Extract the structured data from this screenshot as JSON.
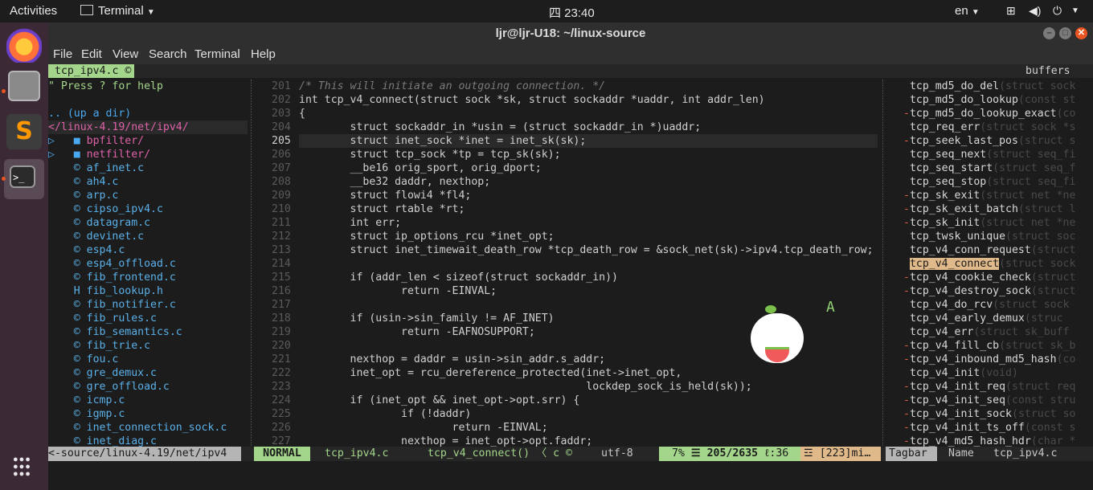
{
  "topbar": {
    "activities": "Activities",
    "app_name": "Terminal",
    "clock": "四 23:40",
    "input_method": "en"
  },
  "window": {
    "title": "ljr@ljr-U18: ~/linux-source",
    "menu": [
      "File",
      "Edit",
      "View",
      "Search",
      "Terminal",
      "Help"
    ]
  },
  "vim": {
    "tab_file": "tcp_ipv4.c",
    "tab_right": "buffers",
    "nerdtree": {
      "help": "\" Press ? for help",
      "up_dir": ".. (up a dir)",
      "cwd": "</linux-4.19/net/ipv4/",
      "dirs": [
        "bpfilter/",
        "netfilter/"
      ],
      "files": [
        "af_inet.c",
        "ah4.c",
        "arp.c",
        "cipso_ipv4.c",
        "datagram.c",
        "devinet.c",
        "esp4.c",
        "esp4_offload.c",
        "fib_frontend.c",
        "fib_lookup.h",
        "fib_notifier.c",
        "fib_rules.c",
        "fib_semantics.c",
        "fib_trie.c",
        "fou.c",
        "gre_demux.c",
        "gre_offload.c",
        "icmp.c",
        "igmp.c",
        "inet_connection_sock.c",
        "inet_diag.c"
      ]
    },
    "code": [
      {
        "n": "201",
        "t": "/* This will initiate an outgoing connection. */"
      },
      {
        "n": "202",
        "t": "int tcp_v4_connect(struct sock *sk, struct sockaddr *uaddr, int addr_len)"
      },
      {
        "n": "203",
        "t": "{"
      },
      {
        "n": "204",
        "t": "        struct sockaddr_in *usin = (struct sockaddr_in *)uaddr;"
      },
      {
        "n": "205",
        "t": "        struct inet_sock *inet = inet_sk(sk);"
      },
      {
        "n": "206",
        "t": "        struct tcp_sock *tp = tcp_sk(sk);"
      },
      {
        "n": "207",
        "t": "        __be16 orig_sport, orig_dport;"
      },
      {
        "n": "208",
        "t": "        __be32 daddr, nexthop;"
      },
      {
        "n": "209",
        "t": "        struct flowi4 *fl4;"
      },
      {
        "n": "210",
        "t": "        struct rtable *rt;"
      },
      {
        "n": "211",
        "t": "        int err;"
      },
      {
        "n": "212",
        "t": "        struct ip_options_rcu *inet_opt;"
      },
      {
        "n": "213",
        "t": "        struct inet_timewait_death_row *tcp_death_row = &sock_net(sk)->ipv4.tcp_death_row;"
      },
      {
        "n": "214",
        "t": ""
      },
      {
        "n": "215",
        "t": "        if (addr_len < sizeof(struct sockaddr_in))"
      },
      {
        "n": "216",
        "t": "                return -EINVAL;"
      },
      {
        "n": "217",
        "t": ""
      },
      {
        "n": "218",
        "t": "        if (usin->sin_family != AF_INET)"
      },
      {
        "n": "219",
        "t": "                return -EAFNOSUPPORT;"
      },
      {
        "n": "220",
        "t": ""
      },
      {
        "n": "221",
        "t": "        nexthop = daddr = usin->sin_addr.s_addr;"
      },
      {
        "n": "222",
        "t": "        inet_opt = rcu_dereference_protected(inet->inet_opt,"
      },
      {
        "n": "223",
        "t": "                                             lockdep_sock_is_held(sk));"
      },
      {
        "n": "224",
        "t": "        if (inet_opt && inet_opt->opt.srr) {"
      },
      {
        "n": "225",
        "t": "                if (!daddr)"
      },
      {
        "n": "226",
        "t": "                        return -EINVAL;"
      },
      {
        "n": "227",
        "t": "                nexthop = inet_opt->opt.faddr;"
      }
    ],
    "tagbar": [
      {
        "m": " ",
        "n": "tcp_md5_do_del",
        "s": "(struct sock"
      },
      {
        "m": " ",
        "n": "tcp_md5_do_lookup",
        "s": "(const st"
      },
      {
        "m": "-",
        "n": "tcp_md5_do_lookup_exact",
        "s": "(co"
      },
      {
        "m": " ",
        "n": "tcp_req_err",
        "s": "(struct sock *s"
      },
      {
        "m": "-",
        "n": "tcp_seek_last_pos",
        "s": "(struct s"
      },
      {
        "m": " ",
        "n": "tcp_seq_next",
        "s": "(struct seq_fi"
      },
      {
        "m": " ",
        "n": "tcp_seq_start",
        "s": "(struct seq_f"
      },
      {
        "m": " ",
        "n": "tcp_seq_stop",
        "s": "(struct seq_fi"
      },
      {
        "m": "-",
        "n": "tcp_sk_exit",
        "s": "(struct net *ne"
      },
      {
        "m": "-",
        "n": "tcp_sk_exit_batch",
        "s": "(struct l"
      },
      {
        "m": "-",
        "n": "tcp_sk_init",
        "s": "(struct net *ne"
      },
      {
        "m": " ",
        "n": "tcp_twsk_unique",
        "s": "(struct soc"
      },
      {
        "m": " ",
        "n": "tcp_v4_conn_request",
        "s": "(struct"
      },
      {
        "m": " ",
        "n": "tcp_v4_connect",
        "s": "(struct sock"
      },
      {
        "m": "-",
        "n": "tcp_v4_cookie_check",
        "s": "(struct"
      },
      {
        "m": "-",
        "n": "tcp_v4_destroy_sock",
        "s": "(struct"
      },
      {
        "m": " ",
        "n": "tcp_v4_do_rcv",
        "s": "(struct sock"
      },
      {
        "m": " ",
        "n": "tcp_v4_early_demux",
        "s": "(struc"
      },
      {
        "m": " ",
        "n": "tcp_v4_err",
        "s": "(struct sk_buff"
      },
      {
        "m": "-",
        "n": "tcp_v4_fill_cb",
        "s": "(struct sk_b"
      },
      {
        "m": "-",
        "n": "tcp_v4_inbound_md5_hash",
        "s": "(co"
      },
      {
        "m": " ",
        "n": "tcp_v4_init",
        "s": "(void)"
      },
      {
        "m": "-",
        "n": "tcp_v4_init_req",
        "s": "(struct req"
      },
      {
        "m": "-",
        "n": "tcp_v4_init_seq",
        "s": "(const stru"
      },
      {
        "m": "-",
        "n": "tcp_v4_init_sock",
        "s": "(struct so"
      },
      {
        "m": "-",
        "n": "tcp_v4_init_ts_off",
        "s": "(const s"
      },
      {
        "m": "-",
        "n": "tcp_v4_md5_hash_hdr",
        "s": "(char *"
      }
    ],
    "status": {
      "tree_path": "<-source/linux-4.19/net/ipv4",
      "mode": "NORMAL",
      "file": "tcp_ipv4.c",
      "func": "tcp_v4_connect() 〈 c",
      "encoding": "utf-8",
      "percent": "7%",
      "position": "☰ 205/2635",
      "col": "ℓ:36",
      "warn": "☲ [223]mi…",
      "tagbar": "Tagbar",
      "sort": "Name",
      "tagbar_file": "tcp_ipv4.c"
    }
  },
  "colors": {
    "accent": "#e95420",
    "vim_green": "#a3d58a",
    "tree_blue": "#4aa8f0"
  }
}
